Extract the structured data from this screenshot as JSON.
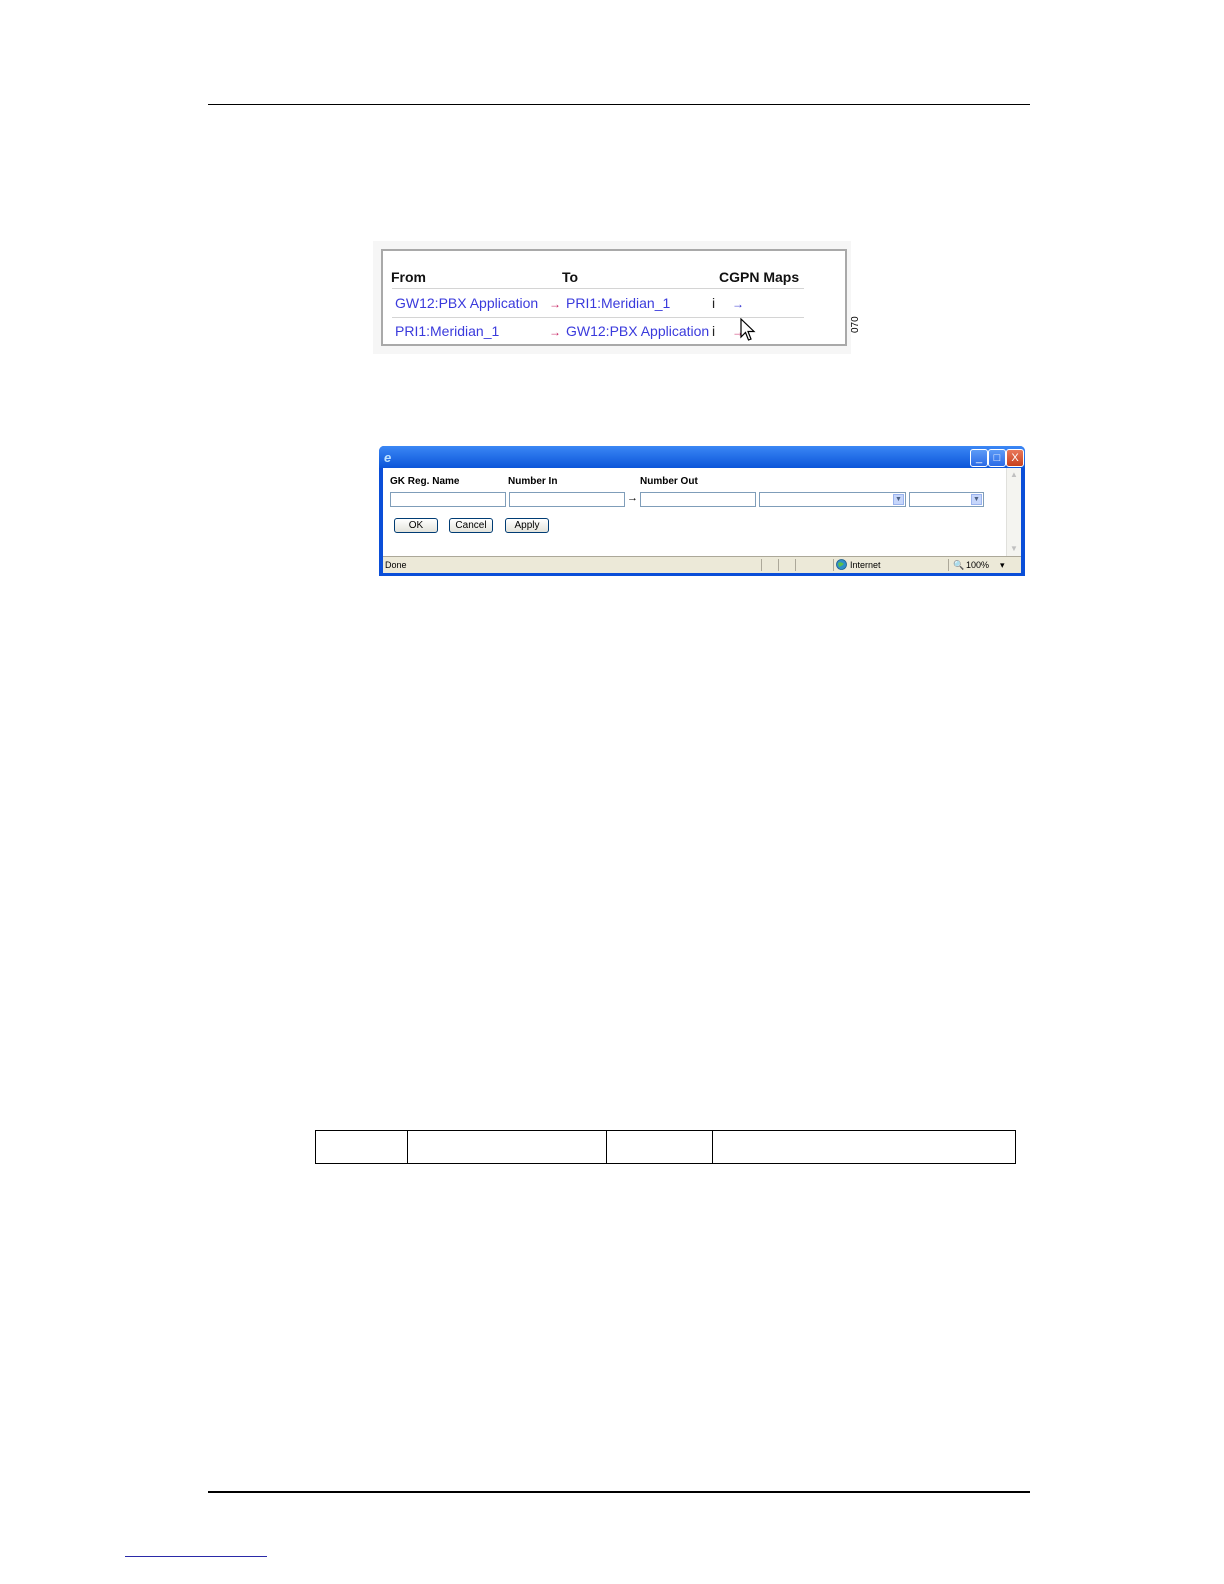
{
  "figure1": {
    "headers": {
      "from": "From",
      "to": "To",
      "cgpn": "CGPN Maps"
    },
    "rows": [
      {
        "from": "GW12:PBX Application",
        "arrow": "→",
        "to": "PRI1:Meridian_1",
        "info": "i",
        "map_arrow": "→"
      },
      {
        "from": "PRI1:Meridian_1",
        "arrow": "→",
        "to": "GW12:PBX Application",
        "info": "i",
        "map_arrow": "→"
      }
    ],
    "figure_id": "070"
  },
  "popup": {
    "labels": {
      "gk_reg_name": "GK Reg. Name",
      "number_in": "Number In",
      "number_out": "Number Out"
    },
    "values": {
      "gk_reg_name": "",
      "number_in": "",
      "number_out": "",
      "select1": "",
      "select2": ""
    },
    "mapping_arrow": "→",
    "buttons": {
      "ok": "OK",
      "cancel": "Cancel",
      "apply": "Apply"
    },
    "status": {
      "left": "Done",
      "zone": "Internet",
      "zoom": "100%"
    },
    "window_buttons": {
      "minimize": "_",
      "maximize": "□",
      "close": "X"
    }
  }
}
